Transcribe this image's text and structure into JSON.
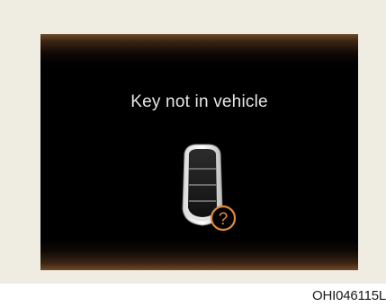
{
  "display": {
    "message": "Key not in vehicle",
    "icons": {
      "key_fob": "smart-key-fob-icon",
      "question_badge": "question-mark-badge-icon",
      "question_glyph": "?"
    },
    "colors": {
      "panel_background": "#efece2",
      "screen_background": "#000000",
      "screen_edge_glow": "#6e4a29",
      "message_text": "#e6e6e6",
      "badge_accent": "#e08a3c"
    }
  },
  "figure_code": "OHI046115L"
}
